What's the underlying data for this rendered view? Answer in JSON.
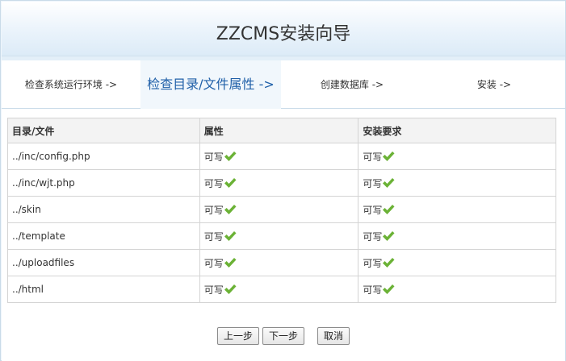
{
  "header": {
    "title": "ZZCMS安装向导"
  },
  "steps": [
    {
      "label": "检查系统运行环境 ->",
      "active": false
    },
    {
      "label": "检查目录/文件属性 ->",
      "active": true
    },
    {
      "label": "创建数据库 ->",
      "active": false
    },
    {
      "label": "安装 ->",
      "active": false
    }
  ],
  "table": {
    "headers": [
      "目录/文件",
      "属性",
      "安装要求"
    ],
    "rows": [
      {
        "path": "../inc/config.php",
        "attr": "可写",
        "req": "可写"
      },
      {
        "path": "../inc/wjt.php",
        "attr": "可写",
        "req": "可写"
      },
      {
        "path": "../skin",
        "attr": "可写",
        "req": "可写"
      },
      {
        "path": "../template",
        "attr": "可写",
        "req": "可写"
      },
      {
        "path": "../uploadfiles",
        "attr": "可写",
        "req": "可写"
      },
      {
        "path": "../html",
        "attr": "可写",
        "req": "可写"
      }
    ]
  },
  "buttons": {
    "prev": "上一步",
    "next": "下一步",
    "cancel": "取消"
  },
  "colors": {
    "active_step": "#1f5fa8",
    "check": "#6bb236"
  },
  "icons": {
    "status": "checkmark-icon"
  }
}
